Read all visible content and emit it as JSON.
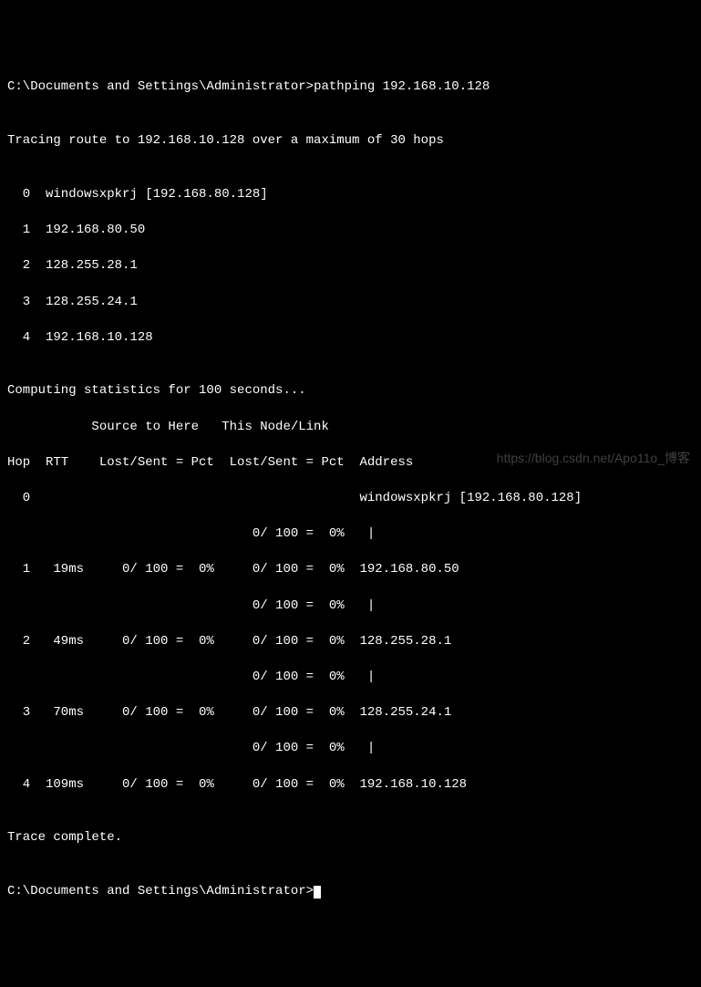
{
  "prompt1": "C:\\Documents and Settings\\Administrator>",
  "command": "pathping 192.168.10.128",
  "blank": "",
  "tracing_header": "Tracing route to 192.168.10.128 over a maximum of 30 hops",
  "route_hops": [
    "  0  windowsxpkrj [192.168.80.128]",
    "  1  192.168.80.50",
    "  2  128.255.28.1",
    "  3  128.255.24.1",
    "  4  192.168.10.128"
  ],
  "computing_header": "Computing statistics for 100 seconds...",
  "col_header1": "           Source to Here   This Node/Link",
  "col_header2": "Hop  RTT    Lost/Sent = Pct  Lost/Sent = Pct  Address",
  "stats_lines": [
    "  0                                           windowsxpkrj [192.168.80.128]",
    "                                0/ 100 =  0%   |",
    "  1   19ms     0/ 100 =  0%     0/ 100 =  0%  192.168.80.50",
    "                                0/ 100 =  0%   |",
    "  2   49ms     0/ 100 =  0%     0/ 100 =  0%  128.255.28.1",
    "                                0/ 100 =  0%   |",
    "  3   70ms     0/ 100 =  0%     0/ 100 =  0%  128.255.24.1",
    "                                0/ 100 =  0%   |",
    "  4  109ms     0/ 100 =  0%     0/ 100 =  0%  192.168.10.128"
  ],
  "trace_complete": "Trace complete.",
  "prompt2": "C:\\Documents and Settings\\Administrator>",
  "watermark": "https://blog.csdn.net/Apo11o_博客"
}
